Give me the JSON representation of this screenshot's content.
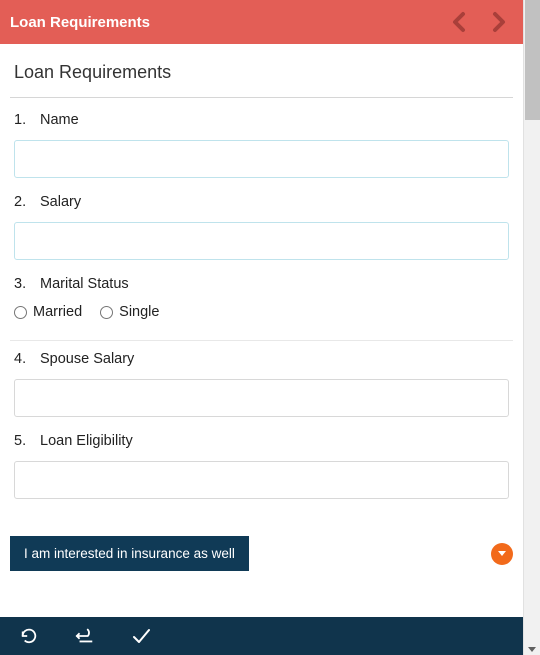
{
  "topbar": {
    "title": "Loan Requirements"
  },
  "form": {
    "title": "Loan Requirements",
    "questions": [
      {
        "num": "1.",
        "label": "Name",
        "type": "text",
        "value": ""
      },
      {
        "num": "2.",
        "label": "Salary",
        "type": "text",
        "value": ""
      },
      {
        "num": "3.",
        "label": "Marital Status",
        "type": "radio"
      },
      {
        "num": "4.",
        "label": "Spouse Salary",
        "type": "text",
        "value": ""
      },
      {
        "num": "5.",
        "label": "Loan Eligibility",
        "type": "text",
        "value": ""
      }
    ],
    "marital_options": {
      "married": "Married",
      "single": "Single"
    },
    "cta_label": "I am interested in insurance as well"
  }
}
